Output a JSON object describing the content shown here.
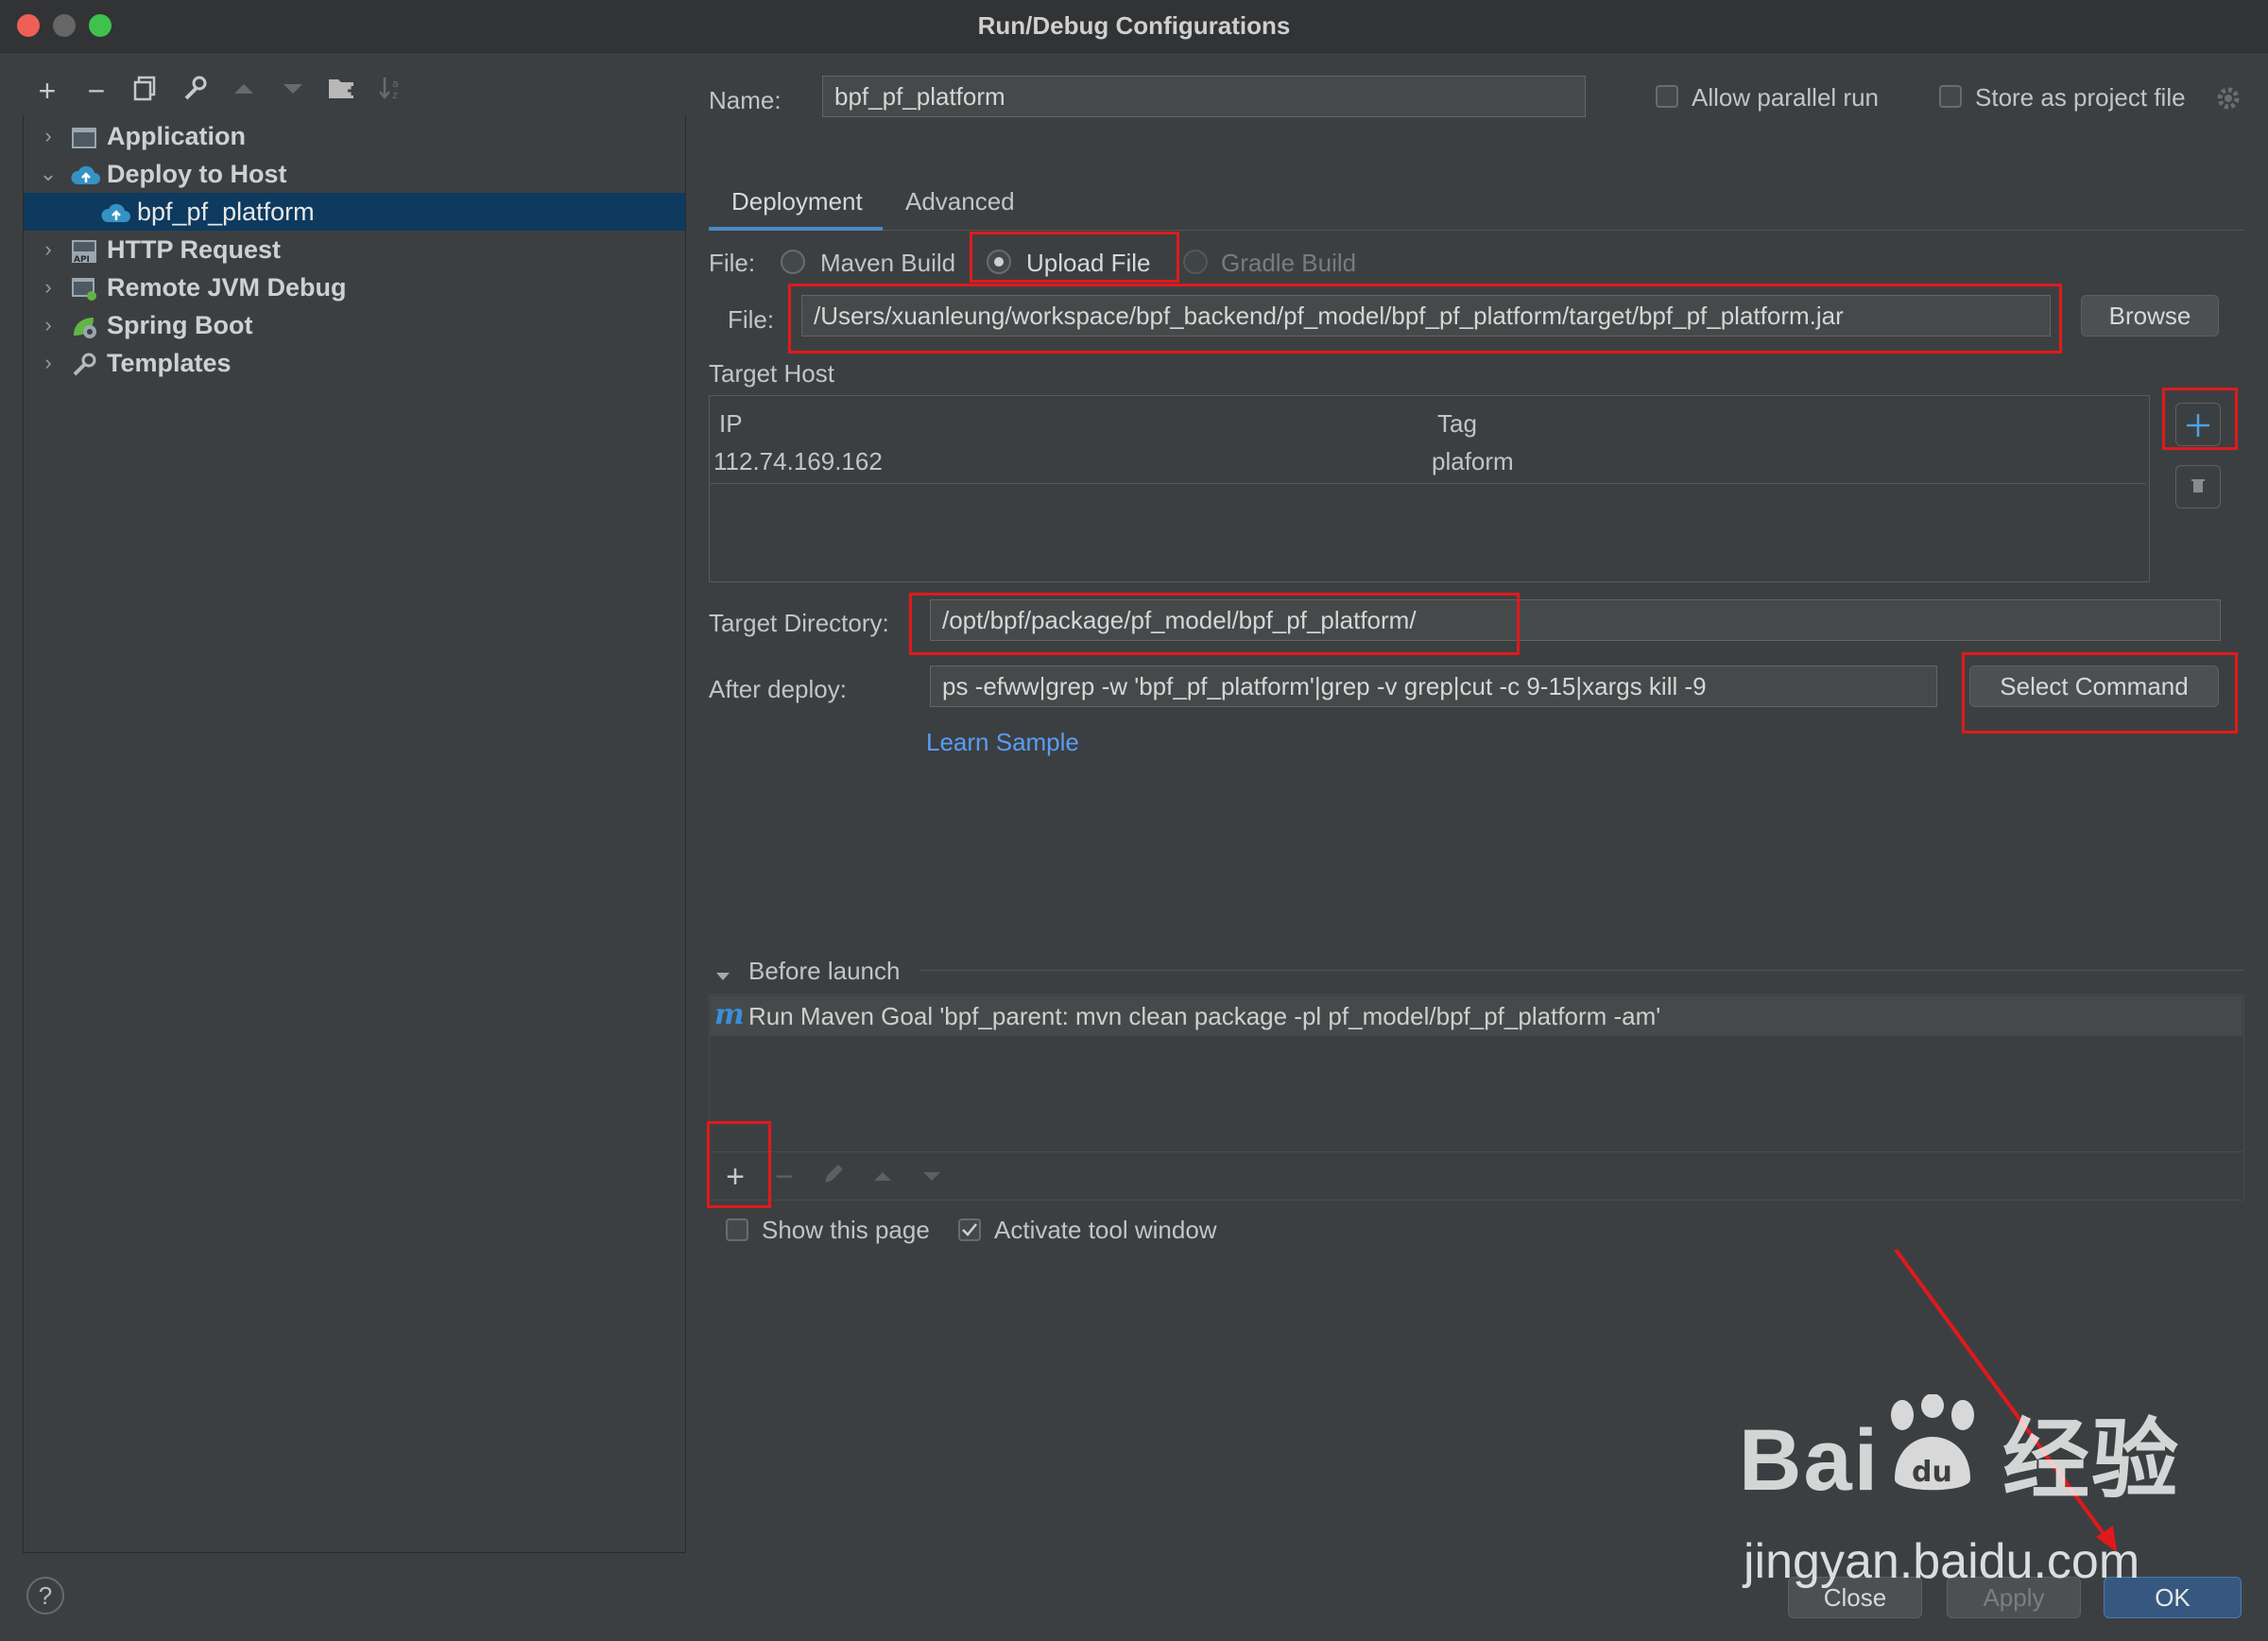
{
  "window": {
    "title": "Run/Debug Configurations"
  },
  "toolbar": {
    "icons": [
      "add-icon",
      "remove-icon",
      "copy-icon",
      "wrench-icon",
      "move-up-icon",
      "move-down-icon",
      "new-folder-icon",
      "sort-icon"
    ]
  },
  "tree": {
    "items": [
      {
        "label": "Application",
        "expanded": false,
        "icon": "application-icon"
      },
      {
        "label": "Deploy to Host",
        "expanded": true,
        "icon": "cloud-upload-icon"
      },
      {
        "label": "bpf_pf_platform",
        "child": true,
        "selected": true,
        "icon": "cloud-upload-icon"
      },
      {
        "label": "HTTP Request",
        "expanded": false,
        "icon": "api-icon"
      },
      {
        "label": "Remote JVM Debug",
        "expanded": false,
        "icon": "remote-debug-icon"
      },
      {
        "label": "Spring Boot",
        "expanded": false,
        "icon": "spring-boot-icon"
      },
      {
        "label": "Templates",
        "expanded": false,
        "icon": "wrench-icon"
      }
    ]
  },
  "config": {
    "name_label": "Name:",
    "name_value": "bpf_pf_platform",
    "allow_parallel_label": "Allow parallel run",
    "store_project_label": "Store as project file",
    "tabs": [
      "Deployment",
      "Advanced"
    ],
    "active_tab": "Deployment",
    "file_type_label": "File:",
    "file_types": [
      "Maven Build",
      "Upload File",
      "Gradle Build"
    ],
    "selected_file_type": "Upload File",
    "file_label": "File:",
    "file_path": "/Users/xuanleung/workspace/bpf_backend/pf_model/bpf_pf_platform/target/bpf_pf_platform.jar",
    "browse_label": "Browse",
    "target_host_label": "Target Host",
    "host_columns": [
      "IP",
      "Tag"
    ],
    "hosts": [
      {
        "ip": "112.74.169.162",
        "tag": "plaform"
      }
    ],
    "target_dir_label": "Target Directory:",
    "target_dir_value": "/opt/bpf/package/pf_model/bpf_pf_platform/",
    "after_deploy_label": "After deploy:",
    "after_deploy_value": "ps -efww|grep -w 'bpf_pf_platform'|grep -v grep|cut -c 9-15|xargs kill -9",
    "select_command_label": "Select Command",
    "learn_sample_label": "Learn Sample"
  },
  "before_launch": {
    "title": "Before launch",
    "task_badge": "m",
    "tasks": [
      "Run Maven Goal 'bpf_parent: mvn clean package -pl pf_model/bpf_pf_platform -am'"
    ],
    "show_page_label": "Show this page",
    "activate_tool_label": "Activate tool window"
  },
  "footer": {
    "help_label": "?",
    "close_label": "Close",
    "apply_label": "Apply",
    "ok_label": "OK"
  },
  "watermark": {
    "line1": "Bai",
    "line1b": "du",
    "line1c": "经验",
    "line2": "jingyan.baidu.com"
  },
  "colors": {
    "accent": "#4a88c7",
    "selection": "#0d3a5e",
    "ok_button": "#365880",
    "highlight_box": "#e0191c",
    "link": "#589df6"
  }
}
